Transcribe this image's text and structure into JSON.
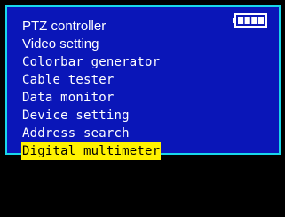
{
  "menu": {
    "items": [
      {
        "label": "PTZ controller",
        "selected": false
      },
      {
        "label": "Video setting",
        "selected": false
      },
      {
        "label": "Colorbar generator",
        "selected": false
      },
      {
        "label": "Cable tester",
        "selected": false
      },
      {
        "label": "Data monitor",
        "selected": false
      },
      {
        "label": "Device setting",
        "selected": false
      },
      {
        "label": "Address search",
        "selected": false
      },
      {
        "label": "Digital multimeter",
        "selected": true
      }
    ]
  },
  "battery": {
    "icon": "battery-icon",
    "level_fraction": 1.0,
    "bars_filled": 4,
    "bars_total": 4
  },
  "colors": {
    "screen_background": "#0a16b8",
    "screen_border": "#18d6ea",
    "text": "#ffffff",
    "selection_highlight": "#fff200",
    "selected_text": "#000000",
    "outer_background": "#000000"
  }
}
